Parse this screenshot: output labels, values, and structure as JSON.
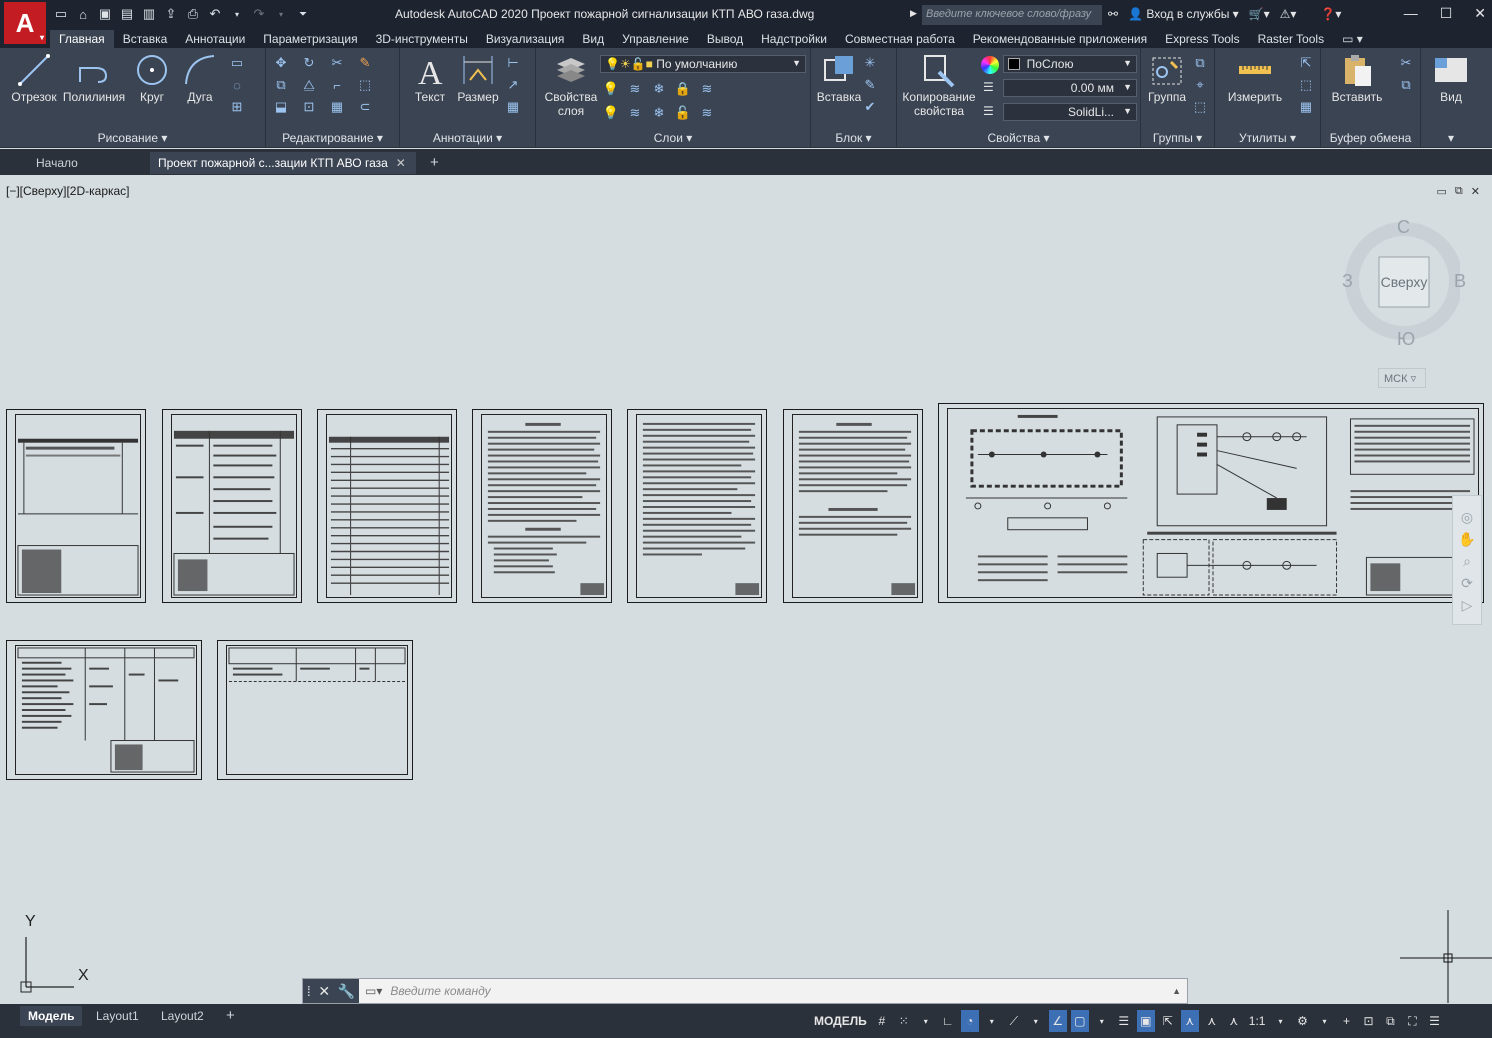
{
  "app": {
    "title": "Autodesk AutoCAD 2020   Проект пожарной сигнализации КТП АВО газа.dwg",
    "logo_letter": "A",
    "search_placeholder": "Введите ключевое слово/фразу",
    "signin_label": "Вход в службы"
  },
  "ribbon_tabs": [
    "Главная",
    "Вставка",
    "Аннотации",
    "Параметризация",
    "3D-инструменты",
    "Визуализация",
    "Вид",
    "Управление",
    "Вывод",
    "Надстройки",
    "Совместная работа",
    "Рекомендованные приложения",
    "Express Tools",
    "Raster Tools"
  ],
  "panels": {
    "draw": {
      "label": "Рисование",
      "line": "Отрезок",
      "polyline": "Полилиния",
      "circle": "Круг",
      "arc": "Дуга"
    },
    "modify": {
      "label": "Редактирование"
    },
    "annotation": {
      "label": "Аннотации",
      "text": "Текст",
      "dimension": "Размер"
    },
    "layers": {
      "label": "Слои",
      "props_line1": "Свойства",
      "props_line2": "слоя",
      "current_layer": "По умолчанию"
    },
    "block": {
      "label": "Блок",
      "insert": "Вставка"
    },
    "properties": {
      "label": "Свойства",
      "match_line1": "Копирование",
      "match_line2": "свойства",
      "color": "ПоСлою",
      "lineweight": "0.00 мм",
      "linetype": "SolidLi..."
    },
    "groups": {
      "label": "Группы",
      "group": "Группа"
    },
    "utilities": {
      "label": "Утилиты",
      "measure": "Измерить"
    },
    "clipboard": {
      "label": "Буфер обмена",
      "paste": "Вставить"
    },
    "view": {
      "label": "Вид"
    }
  },
  "doc_tabs": {
    "start": "Начало",
    "active": "Проект пожарной с...зации КТП АВО газа"
  },
  "viewport": {
    "label": "[−][Сверху][2D-каркас]",
    "viewcube": {
      "face": "Сверху",
      "north": "С",
      "south": "Ю",
      "west": "З",
      "east": "В",
      "ucs": "МСК"
    },
    "ucs_x": "X",
    "ucs_y": "Y"
  },
  "command_line": {
    "placeholder": "Введите  команду"
  },
  "layout_tabs": [
    "Модель",
    "Layout1",
    "Layout2"
  ],
  "status": {
    "model": "МОДЕЛЬ",
    "scale": "1:1"
  }
}
